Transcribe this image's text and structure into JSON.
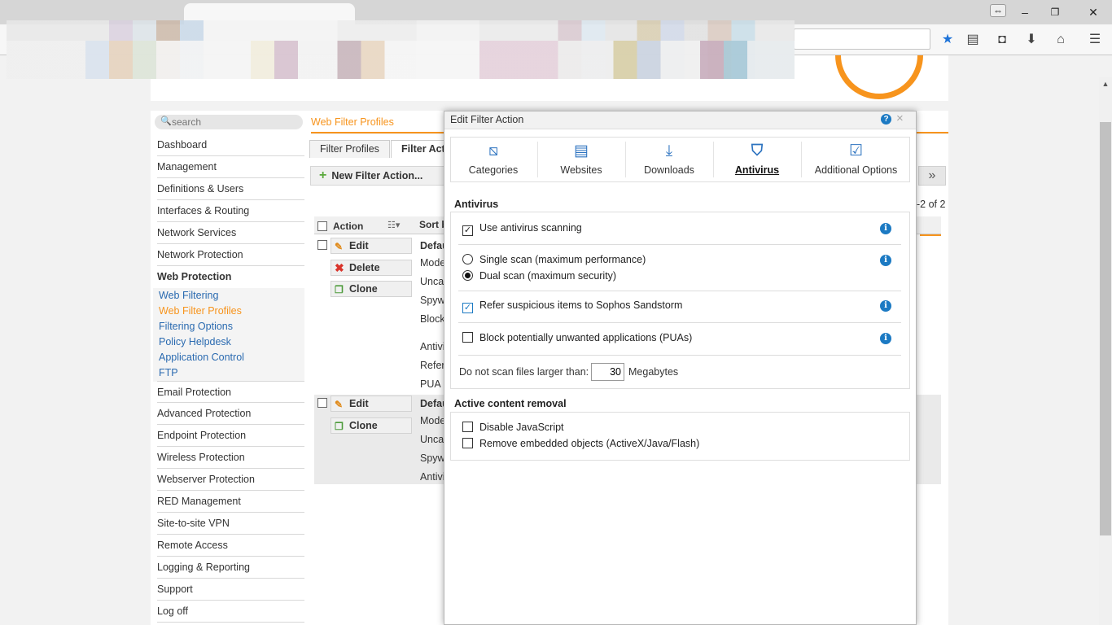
{
  "search": {
    "placeholder": "search"
  },
  "breadcrumb": "Web Filter Profiles",
  "sidebar": {
    "items": [
      "Dashboard",
      "Management",
      "Definitions & Users",
      "Interfaces & Routing",
      "Network Services",
      "Network Protection",
      "Web Protection",
      "Email Protection",
      "Advanced Protection",
      "Endpoint Protection",
      "Wireless Protection",
      "Webserver Protection",
      "RED Management",
      "Site-to-site VPN",
      "Remote Access",
      "Logging & Reporting",
      "Support",
      "Log off"
    ],
    "web_protection_sub": [
      "Web Filtering",
      "Web Filter Profiles",
      "Filtering Options",
      "Policy Helpdesk",
      "Application Control",
      "FTP"
    ]
  },
  "main": {
    "tabs": [
      "Filter Profiles",
      "Filter Acti"
    ],
    "new_button": "New Filter Action...",
    "pager": "-2 of 2",
    "next": "»",
    "table": {
      "col_action": "Action",
      "col_sort": "Sort b",
      "row1": {
        "buttons": [
          "Edit",
          "Delete",
          "Clone"
        ],
        "cells": [
          "Defau",
          "Mode",
          "Unca",
          "Spyw",
          "Block",
          "Antivi",
          "Refer",
          "PUA"
        ]
      },
      "row2": {
        "buttons": [
          "Edit",
          "Clone"
        ],
        "cells": [
          "Defau",
          "Mode",
          "Unca",
          "Spyw",
          "Antivi"
        ]
      }
    }
  },
  "dialog": {
    "title": "Edit Filter Action",
    "help": "?",
    "close": "×",
    "tabs": [
      "Categories",
      "Websites",
      "Downloads",
      "Antivirus",
      "Additional Options"
    ],
    "selected_tab": "Antivirus",
    "antivirus": {
      "title": "Antivirus",
      "use_scanning": {
        "label": "Use antivirus scanning",
        "checked": true
      },
      "single_scan": {
        "label": "Single scan (maximum performance)",
        "selected": false
      },
      "dual_scan": {
        "label": "Dual scan (maximum security)",
        "selected": true
      },
      "sandstorm": {
        "label": "Refer suspicious items to Sophos Sandstorm",
        "checked": true
      },
      "pua": {
        "label": "Block potentially unwanted applications (PUAs)",
        "checked": false
      },
      "size_label": "Do not scan files larger than:",
      "size_value": "30",
      "size_unit": "Megabytes"
    },
    "active_content": {
      "title": "Active content removal",
      "disable_js": {
        "label": "Disable JavaScript",
        "checked": false
      },
      "remove_embedded": {
        "label": "Remove embedded objects (ActiveX/Java/Flash)",
        "checked": false
      }
    }
  },
  "colors": {
    "accent": "#f7941d",
    "link": "#2a6ab0",
    "info": "#1c7ac3"
  }
}
